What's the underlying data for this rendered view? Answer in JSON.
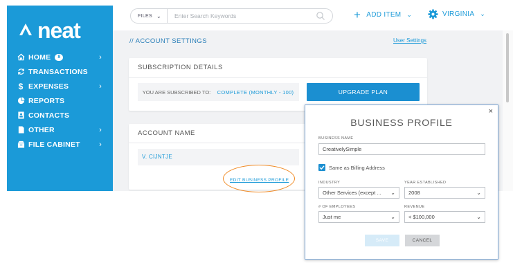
{
  "brand": {
    "logo_text": "neat",
    "color": "#1b9ad8"
  },
  "sidebar": {
    "items": [
      {
        "label": "HOME",
        "icon": "home-icon",
        "badge": "8",
        "has_submenu": true
      },
      {
        "label": "TRANSACTIONS",
        "icon": "sync-icon",
        "has_submenu": false
      },
      {
        "label": "EXPENSES",
        "icon": "dollar-icon",
        "has_submenu": true
      },
      {
        "label": "REPORTS",
        "icon": "pie-chart-icon",
        "has_submenu": false
      },
      {
        "label": "CONTACTS",
        "icon": "contact-card-icon",
        "has_submenu": false
      },
      {
        "label": "OTHER",
        "icon": "document-icon",
        "has_submenu": true
      },
      {
        "label": "FILE CABINET",
        "icon": "file-cabinet-icon",
        "has_submenu": true
      }
    ]
  },
  "topbar": {
    "search_filter": "FILES",
    "search_placeholder": "Enter Search Keywords",
    "add_item_label": "ADD ITEM",
    "user_label": "VIRGINIA"
  },
  "main": {
    "page_title": "// ACCOUNT SETTINGS",
    "user_settings_link": "User Settings",
    "subscription": {
      "heading": "SUBSCRIPTION DETAILS",
      "subscribed_label": "YOU ARE SUBSCRIBED TO:",
      "plan": "COMPLETE (MONTHLY - 100)",
      "upgrade_button": "UPGRADE PLAN"
    },
    "account": {
      "heading": "ACCOUNT NAME",
      "name": "V. CIJNTJE",
      "edit_link": "EDIT BUSINESS PROFILE"
    }
  },
  "modal": {
    "title": "BUSINESS PROFILE",
    "close_glyph": "×",
    "business_name_label": "BUSINESS NAME",
    "business_name_value": "CreativelySimple",
    "billing_checkbox_label": "Same as Billing Address",
    "billing_checked": true,
    "industry_label": "INDUSTRY",
    "industry_value": "Other Services (except ...",
    "year_label": "YEAR ESTABLISHED",
    "year_value": "2008",
    "employees_label": "# OF EMPLOYEES",
    "employees_value": "Just me",
    "revenue_label": "REVENUE",
    "revenue_value": "< $100,000",
    "save_button": "SAVE",
    "cancel_button": "CANCEL"
  },
  "colors": {
    "accent": "#1b9ad8",
    "highlight": "#f08a24",
    "panel_bg": "#f1f2f4"
  }
}
